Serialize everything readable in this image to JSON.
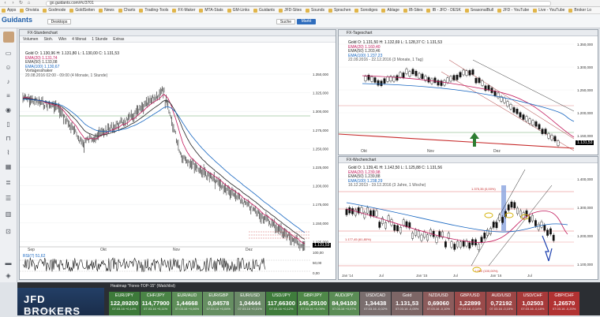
{
  "browser": {
    "url": "go.guidants.com/#c/3701",
    "bookmarks": [
      "Apps",
      "Onvista",
      "Godmode",
      "GoldSeiten",
      "News",
      "Charts",
      "Trading-Tools",
      "FX-Maker",
      "MTA-Stats",
      "GM-Links",
      "Guidants",
      "JFD-Sites",
      "Sounds",
      "Sprachen",
      "Sonstiges",
      "Ablage",
      "IB-Sites",
      "IB - JFD - DESK",
      "SeasonalBull",
      "JFD - YouTube",
      "Live - YouTube",
      "Broker Lo"
    ]
  },
  "app": {
    "logo_main": "Guidants",
    "search_label": "Suche",
    "market_label": "Markt",
    "desktop_label": "Desktops"
  },
  "main_chart": {
    "title": "FX-Stundenchart",
    "toolbar": [
      "Volumen",
      "Stoh.",
      "Wkn",
      "4 Monat",
      "1 Stunde",
      "Extras"
    ],
    "legend": [
      "Gold  O: 1.130,96  H: 1.131,80  L: 1.130,00  C: 1.131,53",
      "EMA(20)  1.131,74",
      "EMA(50)  1.133,08",
      "EMA(100)  1.130,67",
      "Vortagesshaker",
      "20.08.2016 02:00 - 09:00  (4 Monate, 1 Stunde)"
    ],
    "y_ticks": [
      "1.350,000",
      "1.325,000",
      "1.300,000",
      "1.275,000",
      "1.250,000",
      "1.225,000",
      "1.200,000",
      "1.175,000",
      "1.150,000",
      "1.125,000"
    ],
    "x_ticks": [
      "Sep",
      "Okt",
      "Nov",
      "Dez"
    ],
    "last_price": "1.131,53",
    "rsi_label": "RSI(7)  51,62",
    "rsi_ticks": [
      "100,00",
      "50,00",
      "0,00"
    ]
  },
  "daily_chart": {
    "title": "FX-Tageschart",
    "legend": [
      "Gold  O: 1.131,50  H: 1.132,69  L: 1.128,37  C: 1.131,53",
      "EMA(20)  1.160,40",
      "EMA(50)  1.203,46",
      "EMA(100)  1.237,23",
      "22.09.2016 - 22.12.2016  (3 Monate, 1 Tag)"
    ],
    "y_ticks": [
      "1.350,000",
      "1.300,000",
      "1.250,000",
      "1.200,000",
      "1.150,000"
    ],
    "x_ticks": [
      "Okt",
      "Nov",
      "Dez"
    ],
    "last_price": "1.131,53"
  },
  "weekly_chart": {
    "title": "FX-Wochenchart",
    "legend": [
      "Gold  O: 1.139,41  H: 1.142,50  L: 1.125,88  C: 1.131,56",
      "EMA(20)  1.239,98",
      "EMA(50)  1.239,88",
      "EMA(100)  1.238,29",
      "16.12.2013 - 19.12.2016  (3 Jahre, 1 Woche)"
    ],
    "y_ticks": [
      "1.400,000",
      "1.300,000",
      "1.200,000",
      "1.100,000"
    ],
    "x_ticks": [
      "Jan '14",
      "Jul",
      "Jan '15",
      "Jul",
      "Jan '16",
      "Jul"
    ],
    "fib_labels": [
      "1.375,35 (0,00%)",
      "1.177,45 (61,80%)",
      "1.050 (100,00%)"
    ]
  },
  "heatmap": {
    "title": "Heatmap \"Forex-TOP-15\" (Watchlist)",
    "brand": "JFD BROKERS",
    "brand_sub": "NEXT GEN FOREX & CFD BROKER",
    "items": [
      {
        "sym": "EUR/JPY",
        "price": "122,89200",
        "chg": "07.03.16 +0,14%",
        "color": "#3d7a3a"
      },
      {
        "sym": "CHF/JPY",
        "price": "114,77900",
        "chg": "07.03.16 +0,11%",
        "color": "#4a8446"
      },
      {
        "sym": "EUR/AUD",
        "price": "1,44668",
        "chg": "07.03.16 +0,06%",
        "color": "#5e8f59"
      },
      {
        "sym": "EUR/GBP",
        "price": "0,84578",
        "chg": "07.03.16 +0,04%",
        "color": "#668f62"
      },
      {
        "sym": "EUR/USD",
        "price": "1,04444",
        "chg": "07.03.16 +0,01%",
        "color": "#6b8a68"
      },
      {
        "sym": "USD/JPY",
        "price": "117,66300",
        "chg": "07.03.16 +0,12%",
        "color": "#3f7c3c"
      },
      {
        "sym": "GBP/JPY",
        "price": "145,29100",
        "chg": "07.03.16 +0,09%",
        "color": "#4f8849"
      },
      {
        "sym": "AUD/JPY",
        "price": "84,94100",
        "chg": "07.03.16 +0,07%",
        "color": "#5b8d56"
      },
      {
        "sym": "USD/CAD",
        "price": "1,34438",
        "chg": "07.03.16 -0,02%",
        "color": "#7a6e6e"
      },
      {
        "sym": "Gold",
        "price": "1.131,53",
        "chg": "07.03.16 -0,05%",
        "color": "#7d6666"
      },
      {
        "sym": "NZD/USD",
        "price": "0,69060",
        "chg": "07.03.16 -0,10%",
        "color": "#8c5c5c"
      },
      {
        "sym": "GBP/USD",
        "price": "1,22899",
        "chg": "07.03.16 -0,14%",
        "color": "#9a4a4a"
      },
      {
        "sym": "AUD/USD",
        "price": "0,72192",
        "chg": "07.03.16 -0,15%",
        "color": "#9d4646"
      },
      {
        "sym": "USD/CHF",
        "price": "1,02503",
        "chg": "07.03.16 -0,18%",
        "color": "#a83a3a"
      },
      {
        "sym": "GBP/CHF",
        "price": "1,26570",
        "chg": "07.03.16 -0,20%",
        "color": "#b13232"
      }
    ]
  }
}
